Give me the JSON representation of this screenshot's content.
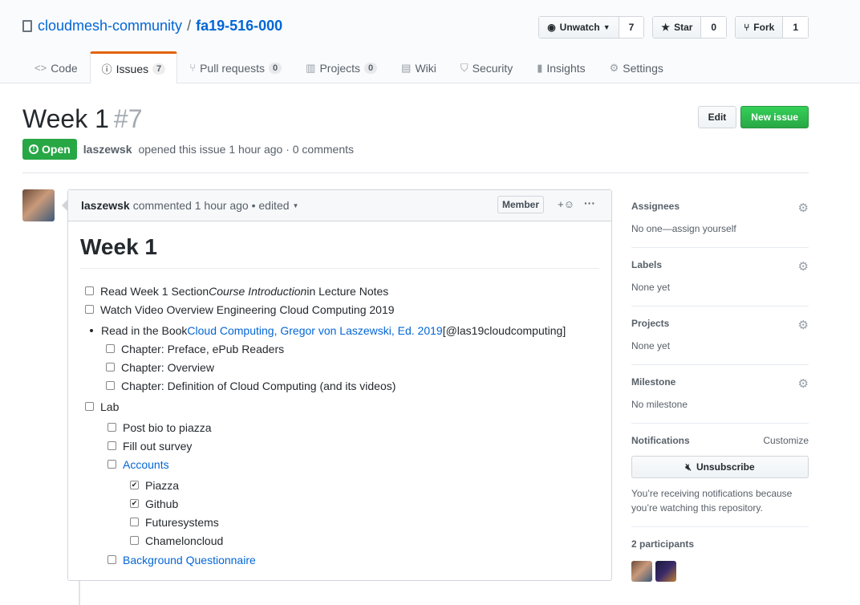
{
  "repo": {
    "owner": "cloudmesh-community",
    "name": "fa19-516-000"
  },
  "actions": [
    {
      "label": "Unwatch",
      "icon": "eye-icon",
      "count": "7"
    },
    {
      "label": "Star",
      "icon": "star-icon",
      "count": "0"
    },
    {
      "label": "Fork",
      "icon": "fork-icon",
      "count": "1"
    }
  ],
  "tabs": [
    {
      "label": "Code",
      "icon": "code-icon"
    },
    {
      "label": "Issues",
      "icon": "issue-icon",
      "count": "7"
    },
    {
      "label": "Pull requests",
      "icon": "pull-request-icon",
      "count": "0"
    },
    {
      "label": "Projects",
      "icon": "project-icon",
      "count": "0"
    },
    {
      "label": "Wiki",
      "icon": "book-icon"
    },
    {
      "label": "Security",
      "icon": "shield-icon"
    },
    {
      "label": "Insights",
      "icon": "graph-icon"
    },
    {
      "label": "Settings",
      "icon": "gear-icon"
    }
  ],
  "issue": {
    "title": "Week 1",
    "number": "#7",
    "state": "Open",
    "author": "laszewsk",
    "meta": "opened this issue 1 hour ago · 0 comments",
    "edit": "Edit",
    "new_issue": "New issue"
  },
  "comment": {
    "author": "laszewsk",
    "time": "commented 1 hour ago • edited",
    "role": "Member",
    "heading": "Week 1",
    "items": [
      {
        "a": "Read Week 1 Section ",
        "b": "Course Introduction",
        "c": " in Lecture Notes",
        "checked": false
      },
      {
        "text": "Watch Video Overview Engineering Cloud Computing 2019",
        "checked": false
      },
      {
        "pre": "Read in the Book ",
        "link": "Cloud Computing, Gregor von Laszewski, Ed. 2019",
        "post": "[@las19cloudcomputing]"
      },
      {
        "text": "Chapter: Preface, ePub Readers",
        "checked": false
      },
      {
        "text": "Chapter: Overview",
        "checked": false
      },
      {
        "text": "Chapter: Definition of Cloud Computing (and its videos)",
        "checked": false
      },
      {
        "text": "Lab",
        "checked": false
      },
      {
        "text": "Post bio to piazza",
        "checked": false
      },
      {
        "text": "Fill out survey",
        "checked": false
      },
      {
        "text": "Accounts",
        "checked": false
      },
      {
        "text": "Piazza",
        "checked": true
      },
      {
        "text": "Github",
        "checked": true
      },
      {
        "text": "Futuresystems",
        "checked": false
      },
      {
        "text": "Chameloncloud",
        "checked": false
      },
      {
        "text": "Background Questionnaire",
        "checked": false
      }
    ]
  },
  "sidebar": {
    "assignees": "Assignees",
    "assignees_val": "No one—assign yourself",
    "labels": "Labels",
    "labels_val": "None yet",
    "projects": "Projects",
    "projects_val": "None yet",
    "milestone": "Milestone",
    "milestone_val": "No milestone",
    "notifications": "Notifications",
    "customize": "Customize",
    "unsubscribe": "Unsubscribe",
    "notif_text": "You’re receiving notifications because you’re watching this repository.",
    "participants": "2 participants"
  },
  "colors": {
    "accent": "#e36209",
    "open": "#28a745",
    "link": "#0366d6"
  }
}
